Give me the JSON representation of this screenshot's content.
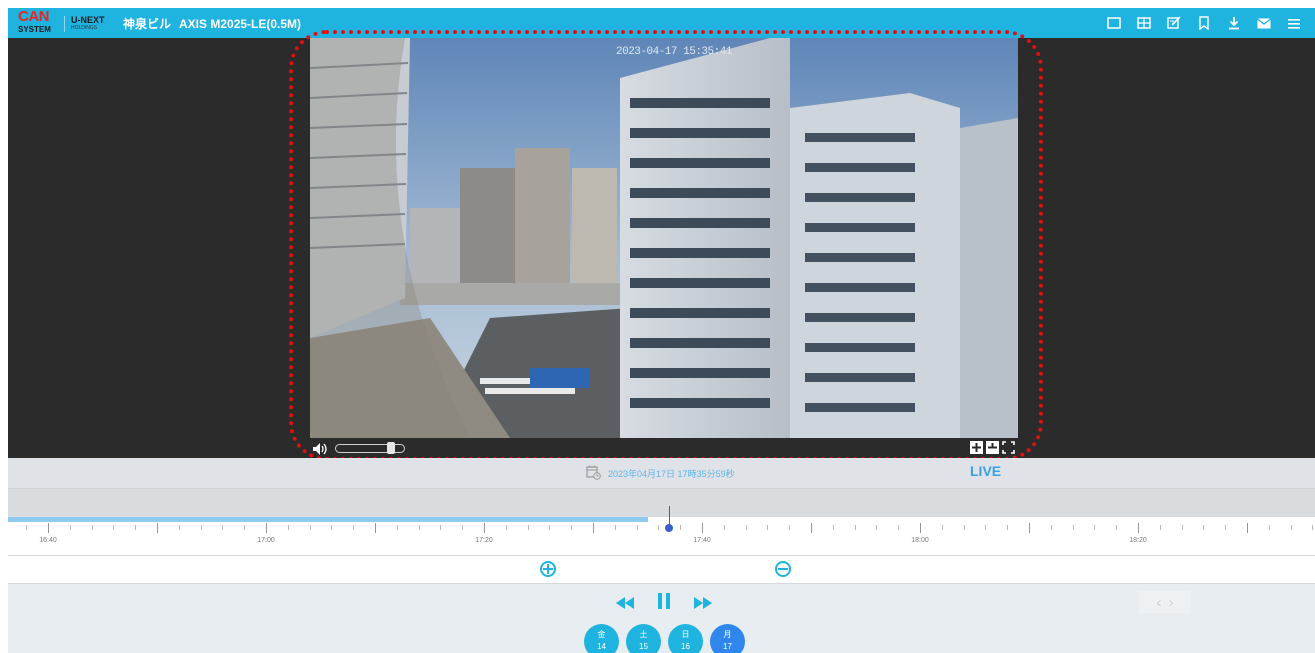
{
  "header": {
    "logo_can": "CAN",
    "logo_system": "SYSTEM",
    "logo_unext": "U-NEXT",
    "logo_holdings": "HOLDINGS",
    "location": "神泉ビル",
    "camera": "AXIS M2025-LE(0.5M)",
    "icons": [
      "single-view-icon",
      "grid-view-icon",
      "edit-icon",
      "bookmark-icon",
      "download-icon",
      "mail-icon",
      "menu-icon"
    ]
  },
  "video": {
    "timestamp_overlay": "2023-04-17 15:35:41"
  },
  "player_controls": {
    "volume_level": 0.85,
    "icons": [
      "volume-icon",
      "add-icon",
      "remove-icon",
      "fullscreen-icon"
    ]
  },
  "datebar": {
    "datetime": "2023年04月17日 17時35分59秒",
    "live_label": "LIVE"
  },
  "timeline": {
    "tick_labels": [
      "16:40",
      "17:00",
      "17:20",
      "17:40",
      "18:00",
      "18:20"
    ],
    "start_minutes": 1000,
    "minutes_per_label": 20,
    "recorded_until": "17:35",
    "cursor_time": "17:37"
  },
  "playback": {
    "rewind_icon": "rewind-icon",
    "pause_icon": "pause-icon",
    "forward_icon": "fast-forward-icon",
    "nav_prev": "‹",
    "nav_next": "›"
  },
  "days": [
    {
      "weekday": "金",
      "date": "14",
      "active": false
    },
    {
      "weekday": "土",
      "date": "15",
      "active": false
    },
    {
      "weekday": "日",
      "date": "16",
      "active": false
    },
    {
      "weekday": "月",
      "date": "17",
      "active": true
    }
  ],
  "colors": {
    "accent": "#1fb4e0",
    "active_day": "#2f87ee",
    "annotation": "#e01010"
  }
}
